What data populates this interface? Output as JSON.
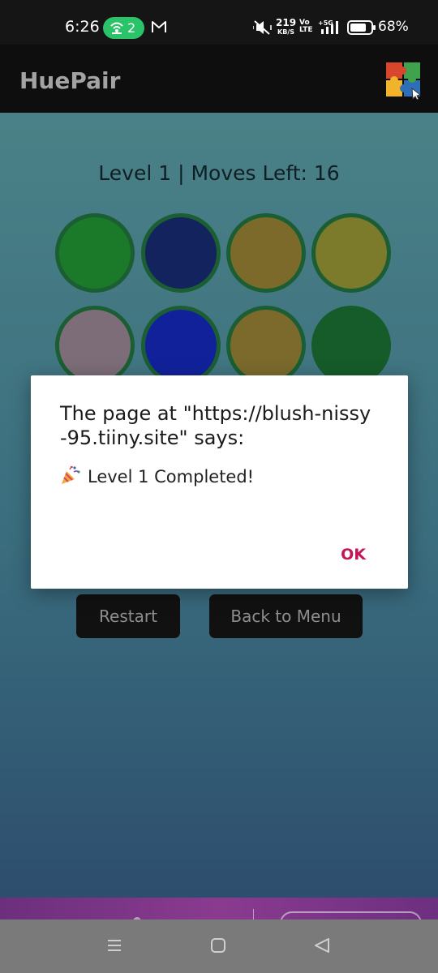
{
  "status_bar": {
    "time": "6:26",
    "hotspot_count": "2",
    "net_speed_value": "219",
    "net_speed_unit": "KB/S",
    "volte_line1": "Vo",
    "volte_line2": "LTE",
    "network_type": "5G",
    "battery_percent": "68%"
  },
  "app_bar": {
    "title": "HuePair"
  },
  "game": {
    "level_status": "Level 1 | Moves Left: 16",
    "circles": [
      {
        "color": "#1a7a2a"
      },
      {
        "color": "#13235e"
      },
      {
        "color": "#7b6a2a"
      },
      {
        "color": "#7c7a2b"
      },
      {
        "color": "#7c6d78"
      },
      {
        "color": "#11219a"
      },
      {
        "color": "#7b6a2c"
      },
      {
        "color": "#155c2a"
      }
    ],
    "restart_label": "Restart",
    "back_to_menu_label": "Back to Menu"
  },
  "dialog": {
    "title": "The page at \"https://blush-nissy-95.tiiny.site\" says:",
    "title_line1": "The page at \"https://blush-nissy",
    "title_line2": "-95.tiiny.site\" says:",
    "message": "Level 1 Completed!",
    "message_icon": "party-popper-icon",
    "ok_label": "OK"
  },
  "colors": {
    "accent_ok": "#c2185b",
    "hotspot_green": "#2bc36a"
  }
}
